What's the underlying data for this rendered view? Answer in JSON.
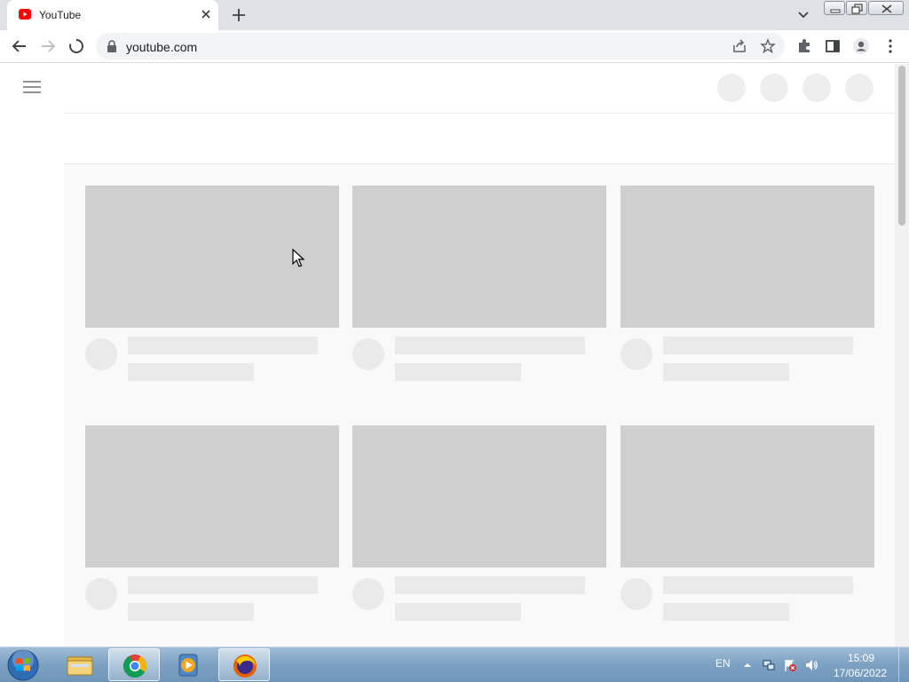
{
  "browser": {
    "tab_title": "YouTube",
    "url": "youtube.com"
  },
  "icons": {
    "tab": [
      "youtube-favicon-icon",
      "close-icon",
      "plus-icon",
      "chevron-down-icon"
    ],
    "window": [
      "minimize-icon",
      "restore-icon",
      "close-icon"
    ],
    "toolbar": [
      "back-arrow-icon",
      "forward-arrow-icon",
      "stop-loading-icon",
      "lock-icon",
      "share-icon",
      "star-icon",
      "puzzle-icon",
      "side-panel-icon",
      "profile-icon",
      "more-vert-icon"
    ],
    "page": [
      "hamburger-menu-icon",
      "mouse-cursor-icon"
    ],
    "taskbar": [
      "windows-start-icon",
      "file-explorer-icon",
      "chrome-icon",
      "media-player-icon",
      "firefox-icon",
      "chevron-up-icon",
      "network-icon",
      "flag-icon",
      "speaker-icon"
    ]
  },
  "colors": {
    "skeleton": "#cfcfcf",
    "skeleton_light": "#eaeaea",
    "content_bg": "#f9f9f9",
    "youtube_red": "#ff0000"
  },
  "page": {
    "state": "loading",
    "placeholder_cards": 6
  },
  "taskbar": {
    "language": "EN",
    "time": "15:09",
    "date": "17/06/2022"
  }
}
